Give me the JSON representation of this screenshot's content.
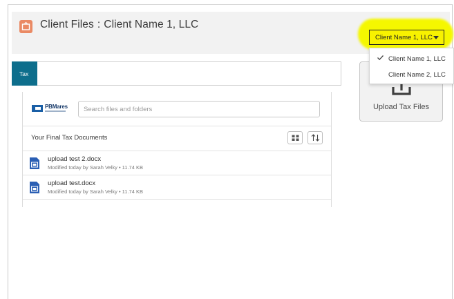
{
  "header": {
    "title": "Client Files",
    "separator": ":",
    "client_name": "Client Name 1, LLC"
  },
  "client_select": {
    "selected": "Client Name 1, LLC",
    "options": [
      "Client Name 1, LLC",
      "Client Name 2, LLC"
    ]
  },
  "upload": {
    "label": "Upload Tax Files"
  },
  "tabs": [
    {
      "label": "Tax",
      "active": true
    }
  ],
  "search": {
    "placeholder": "Search files and folders"
  },
  "logo": {
    "text": "PBMares"
  },
  "list": {
    "title": "Your Final Tax Documents",
    "files": [
      {
        "name": "upload test 2.docx",
        "meta": "Modified today by Sarah Velky • 11.74 KB"
      },
      {
        "name": "upload test.docx",
        "meta": "Modified today by Sarah Velky • 11.74 KB"
      }
    ]
  },
  "colors": {
    "accent_teal": "#0d6e8c",
    "highlight_yellow": "#f5f700",
    "header_icon": "#ea8a64",
    "doc_blue": "#2b5fb4"
  },
  "icons": [
    "briefcase-icon",
    "chevron-down-icon",
    "check-icon",
    "upload-icon",
    "grid-view-icon",
    "sort-icon",
    "word-doc-icon"
  ]
}
